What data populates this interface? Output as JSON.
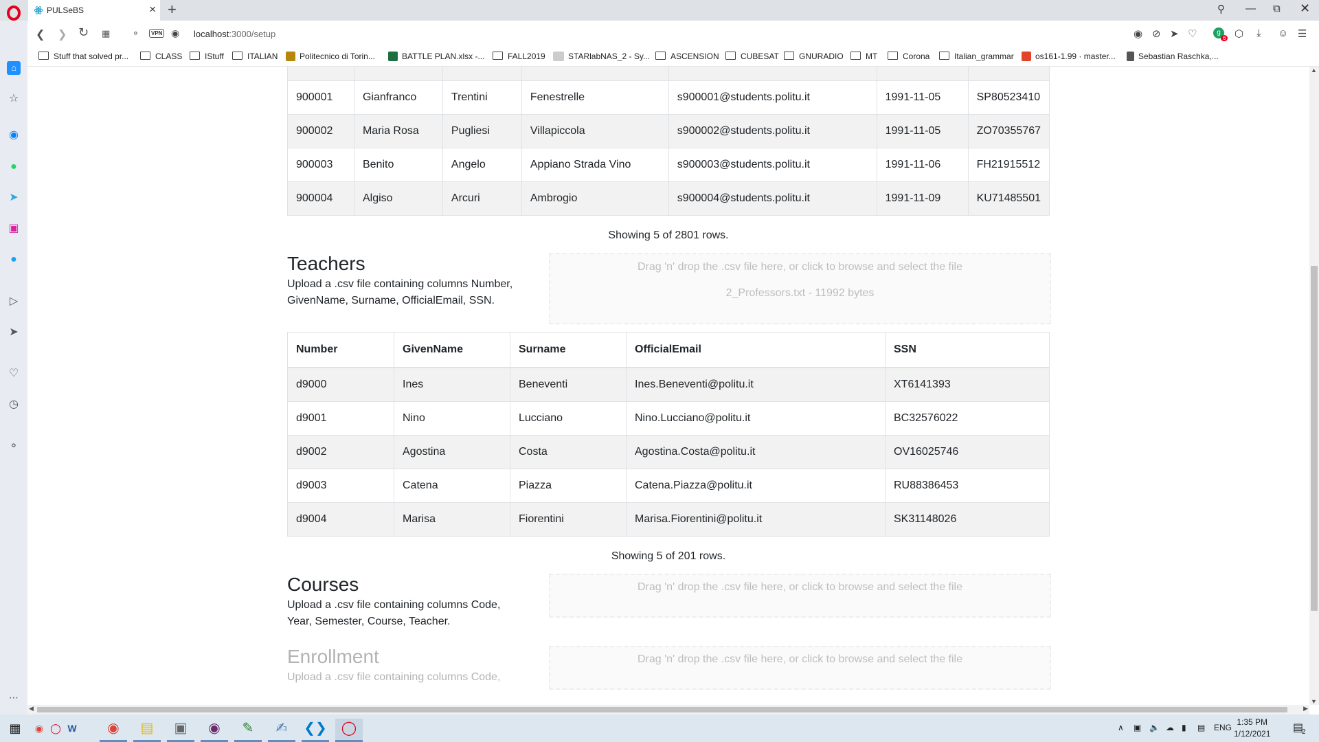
{
  "browser": {
    "tab_title": "PULSeBS",
    "url_host": "localhost",
    "url_path": ":3000/setup",
    "vpn_label": "VPN",
    "bookmarks": [
      "Stuff that solved pr...",
      "CLASS",
      "IStuff",
      "ITALIAN",
      "Politecnico di Torin...",
      "BATTLE PLAN.xlsx -...",
      "FALL2019",
      "STARlabNAS_2 - Sy...",
      "ASCENSION",
      "CUBESAT",
      "GNURADIO",
      "MT",
      "Corona",
      "Italian_grammar",
      "os161-1.99 · master...",
      "Sebastian Raschka,..."
    ],
    "notif_badge": "6"
  },
  "students_table": {
    "rows": [
      [
        "900001",
        "Gianfranco",
        "Trentini",
        "Fenestrelle",
        "s900001@students.politu.it",
        "1991-11-05",
        "SP80523410"
      ],
      [
        "900002",
        "Maria Rosa",
        "Pugliesi",
        "Villapiccola",
        "s900002@students.politu.it",
        "1991-11-05",
        "ZO70355767"
      ],
      [
        "900003",
        "Benito",
        "Angelo",
        "Appiano Strada Vino",
        "s900003@students.politu.it",
        "1991-11-06",
        "FH21915512"
      ],
      [
        "900004",
        "Algiso",
        "Arcuri",
        "Ambrogio",
        "s900004@students.politu.it",
        "1991-11-09",
        "KU71485501"
      ]
    ],
    "showing": "Showing 5 of 2801 rows."
  },
  "teachers": {
    "title": "Teachers",
    "description": "Upload a .csv file containing columns Number, GivenName, Surname, OfficialEmail, SSN.",
    "dropzone_text": "Drag 'n' drop the .csv file here, or click to browse and select the file",
    "file_info": "2_Professors.txt - 11992 bytes",
    "headers": [
      "Number",
      "GivenName",
      "Surname",
      "OfficialEmail",
      "SSN"
    ],
    "rows": [
      [
        "d9000",
        "Ines",
        "Beneventi",
        "Ines.Beneventi@politu.it",
        "XT6141393"
      ],
      [
        "d9001",
        "Nino",
        "Lucciano",
        "Nino.Lucciano@politu.it",
        "BC32576022"
      ],
      [
        "d9002",
        "Agostina",
        "Costa",
        "Agostina.Costa@politu.it",
        "OV16025746"
      ],
      [
        "d9003",
        "Catena",
        "Piazza",
        "Catena.Piazza@politu.it",
        "RU88386453"
      ],
      [
        "d9004",
        "Marisa",
        "Fiorentini",
        "Marisa.Fiorentini@politu.it",
        "SK31148026"
      ]
    ],
    "showing": "Showing 5 of 201 rows."
  },
  "courses": {
    "title": "Courses",
    "description": "Upload a .csv file containing columns Code, Year, Semester, Course, Teacher.",
    "dropzone_text": "Drag 'n' drop the .csv file here, or click to browse and select the file"
  },
  "enrollment": {
    "title": "Enrollment",
    "description": "Upload a .csv file containing columns Code,",
    "dropzone_text": "Drag 'n' drop the .csv file here, or click to browse and select the file"
  },
  "taskbar": {
    "lang": "ENG",
    "time": "1:35 PM",
    "date": "1/12/2021",
    "notif_count": "2"
  },
  "colors": {
    "tabbar": "#dee1e6",
    "sidebar": "#e8ecf2",
    "opera_red": "#e3001b",
    "row_stripe": "#f2f2f2",
    "taskbar": "#dce7f0"
  }
}
